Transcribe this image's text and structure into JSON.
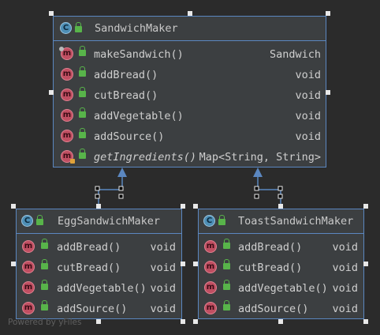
{
  "sandwich_maker": {
    "name": "SandwichMaker",
    "class_icon": "C",
    "methods": [
      {
        "name": "makeSandwich()",
        "type": "Sandwich",
        "icon": "m"
      },
      {
        "name": "addBread()",
        "type": "void",
        "icon": "m"
      },
      {
        "name": "cutBread()",
        "type": "void",
        "icon": "m"
      },
      {
        "name": "addVegetable()",
        "type": "void",
        "icon": "m"
      },
      {
        "name": "addSource()",
        "type": "void",
        "icon": "m"
      },
      {
        "name": "getIngredients()",
        "type": "Map<String, String>",
        "icon": "m"
      }
    ]
  },
  "egg_sandwich_maker": {
    "name": "EggSandwichMaker",
    "class_icon": "C",
    "methods": [
      {
        "name": "addBread()",
        "type": "void",
        "icon": "m"
      },
      {
        "name": "cutBread()",
        "type": "void",
        "icon": "m"
      },
      {
        "name": "addVegetable()",
        "type": "void",
        "icon": "m"
      },
      {
        "name": "addSource()",
        "type": "void",
        "icon": "m"
      }
    ]
  },
  "toast_sandwich_maker": {
    "name": "ToastSandwichMaker",
    "class_icon": "C",
    "methods": [
      {
        "name": "addBread()",
        "type": "void",
        "icon": "m"
      },
      {
        "name": "cutBread()",
        "type": "void",
        "icon": "m"
      },
      {
        "name": "addVegetable()",
        "type": "void",
        "icon": "m"
      },
      {
        "name": "addSource()",
        "type": "void",
        "icon": "m"
      }
    ]
  },
  "footer": "Powered by yFiles",
  "colors": {
    "border": "#5b87c0",
    "background": "#2b2b2b",
    "node_fill": "#3c3f41",
    "method_icon": "#c04f62",
    "class_icon": "#4e8fb6",
    "lock_icon": "#58b44a"
  }
}
